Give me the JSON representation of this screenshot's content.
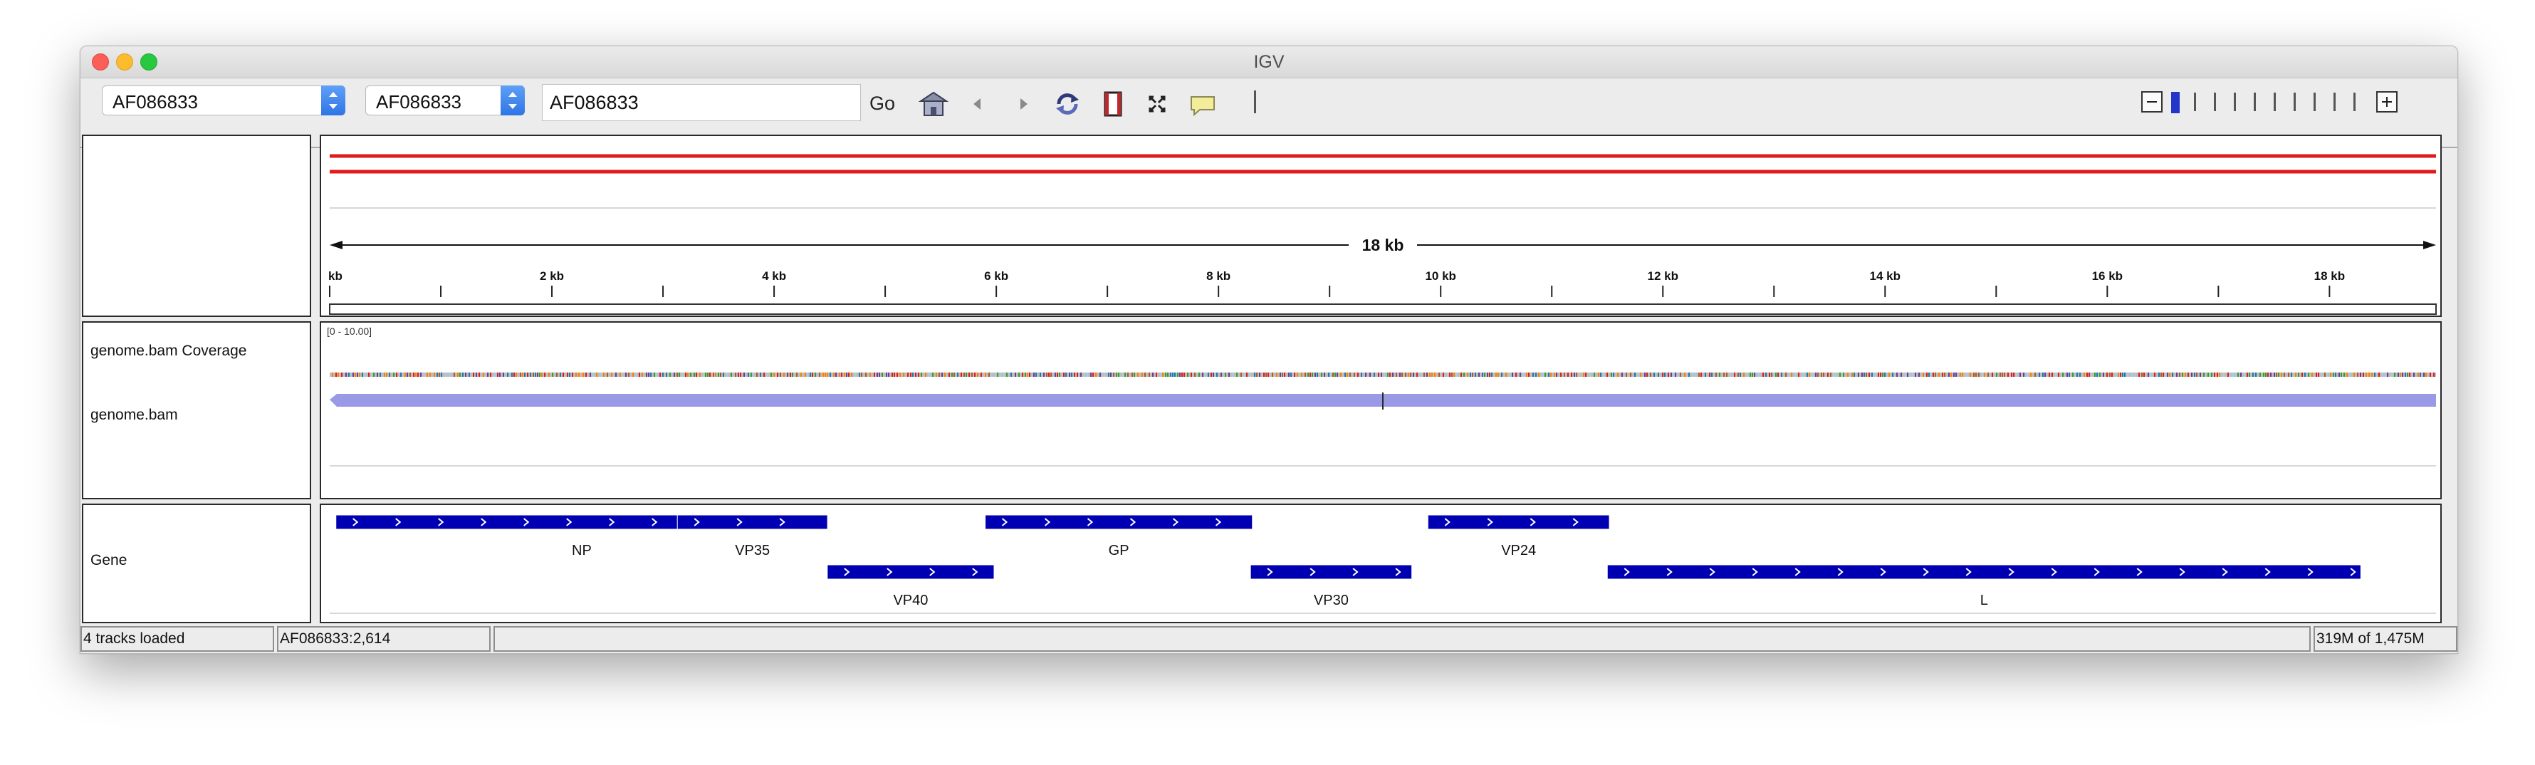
{
  "window": {
    "title": "IGV"
  },
  "toolbar": {
    "genome_value": "AF086833",
    "chromosome_value": "AF086833",
    "locus_value": "AF086833",
    "go_label": "Go",
    "icons": [
      "home-icon",
      "back-icon",
      "forward-icon",
      "refresh-icon",
      "region-of-interest-icon",
      "fit-to-window-icon",
      "popup-info-icon"
    ],
    "zoom_level": 1,
    "zoom_levels": 11
  },
  "ruler": {
    "span_label": "18 kb",
    "tick_labels": [
      "kb",
      "2 kb",
      "4 kb",
      "6 kb",
      "8 kb",
      "10 kb",
      "12 kb",
      "14 kb",
      "16 kb",
      "18 kb"
    ]
  },
  "tracks": {
    "coverage_label": "genome.bam Coverage",
    "coverage_range": "[0 - 10.00]",
    "alignment_label": "genome.bam",
    "gene_label": "Gene"
  },
  "genes": [
    {
      "name": "NP",
      "start": 56,
      "end": 4481,
      "row": 0
    },
    {
      "name": "VP35",
      "start": 3129,
      "end": 4481,
      "row": 0
    },
    {
      "name": "VP40",
      "start": 4479,
      "end": 5980,
      "row": 1
    },
    {
      "name": "GP",
      "start": 5900,
      "end": 8305,
      "row": 0
    },
    {
      "name": "VP30",
      "start": 8288,
      "end": 9740,
      "row": 1
    },
    {
      "name": "VP24",
      "start": 9885,
      "end": 11518,
      "row": 0
    },
    {
      "name": "L",
      "start": 11500,
      "end": 18282,
      "row": 1
    }
  ],
  "genome_length": 18959,
  "colors": {
    "gene": "#0000b2",
    "alignment": "#9999e6",
    "ruler_red": "#e31a1c",
    "zoom_selected": "#2436c9"
  },
  "status": {
    "tracks_loaded": "4 tracks loaded",
    "position": "AF086833:2,614",
    "message": "",
    "memory": "319M of 1,475M"
  }
}
